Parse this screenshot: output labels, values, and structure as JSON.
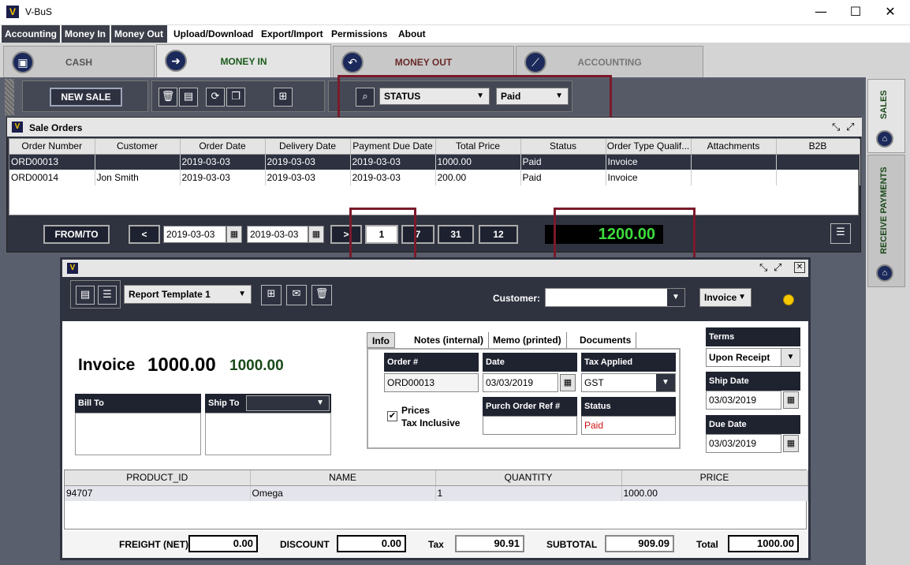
{
  "window": {
    "title": "V-BuS",
    "minimize": "—",
    "maximize": "☐",
    "close": "✕"
  },
  "menu": [
    "Accounting",
    "Money In",
    "Money Out",
    "Upload/Download",
    "Export/Import",
    "Permissions",
    "About"
  ],
  "main_tabs": [
    {
      "label": "CASH"
    },
    {
      "label": "MONEY IN"
    },
    {
      "label": "MONEY OUT"
    },
    {
      "label": "ACCOUNTING"
    }
  ],
  "side_tabs": [
    {
      "label": "SALES"
    },
    {
      "label": "RECEIVE PAYMENTS"
    }
  ],
  "toolbar": {
    "new_sale": "NEW SALE",
    "filter_field": "STATUS",
    "filter_value": "Paid"
  },
  "sale_orders": {
    "title": "Sale Orders",
    "columns": [
      "Order Number",
      "Customer",
      "Order Date",
      "Delivery Date",
      "Payment Due Date",
      "Total Price",
      "Status",
      "Order Type Qualif...",
      "Attachments",
      "B2B"
    ],
    "rows": [
      [
        "ORD00013",
        "",
        "2019-03-03",
        "2019-03-03",
        "2019-03-03",
        "1000.00",
        "Paid",
        "Invoice",
        "",
        ""
      ],
      [
        "ORD00014",
        "Jon Smith",
        "2019-03-03",
        "2019-03-03",
        "2019-03-03",
        "200.00",
        "Paid",
        "Invoice",
        "",
        ""
      ]
    ],
    "footer": {
      "from_to": "FROM/TO",
      "prev": "<",
      "date_from": "2019-03-03",
      "date_to": "2019-03-03",
      "next": ">",
      "periods": [
        "1",
        "7",
        "31",
        "12"
      ],
      "total": "1200.00"
    }
  },
  "invoice": {
    "template": "Report Template 1",
    "customer_label": "Customer:",
    "customer_value": "",
    "doc_type": "Invoice",
    "heading": "Invoice",
    "amount_big": "1000.00",
    "amount_green": "1000.00",
    "bill_to": "Bill To",
    "ship_to": "Ship To",
    "tabs": [
      "Info",
      "Notes (internal)",
      "Memo (printed)",
      "Documents"
    ],
    "order_label": "Order #",
    "order_value": "ORD00013",
    "date_label": "Date",
    "date_value": "03/03/2019",
    "tax_label": "Tax Applied",
    "tax_value": "GST",
    "prices_label": "Prices",
    "tax_incl_label": "Tax Inclusive",
    "purch_label": "Purch Order Ref #",
    "purch_value": "",
    "status_label": "Status",
    "status_value": "Paid",
    "terms_label": "Terms",
    "terms_value": "Upon Receipt",
    "ship_date_label": "Ship Date",
    "ship_date_value": "03/03/2019",
    "due_date_label": "Due Date",
    "due_date_value": "03/03/2019",
    "line_columns": [
      "PRODUCT_ID",
      "NAME",
      "QUANTITY",
      "PRICE"
    ],
    "lines": [
      [
        "94707",
        "Omega",
        "1",
        "1000.00"
      ]
    ],
    "footer": {
      "freight_label": "FREIGHT (NET)",
      "freight": "0.00",
      "discount_label": "DISCOUNT",
      "discount": "0.00",
      "tax_label": "Tax",
      "tax": "90.91",
      "subtotal_label": "SUBTOTAL",
      "subtotal": "909.09",
      "total_label": "Total",
      "total": "1000.00"
    }
  },
  "colors": {
    "panel_dark": "#2f3340",
    "total_green": "#3cdc3c",
    "status_red": "#cc1111",
    "highlight_box": "#7a1a2a"
  }
}
